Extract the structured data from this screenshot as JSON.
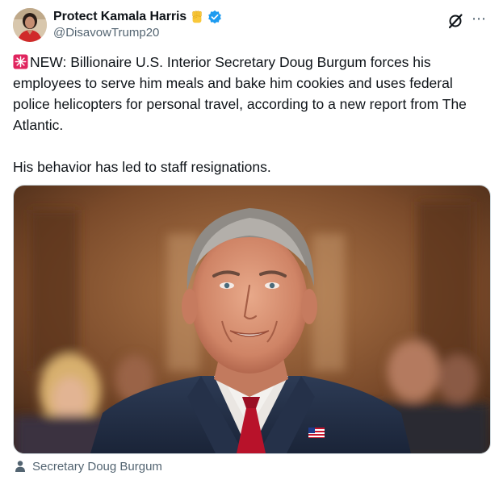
{
  "author": {
    "display_name": "Protect Kamala Harris",
    "handle": "@DisavowTrump20"
  },
  "header_icons": [
    "raised-fist-emoji-icon",
    "verified-badge-icon",
    "grok-icon",
    "more-options-icon"
  ],
  "tweet": {
    "paragraph_1": "NEW: Billionaire U.S. Interior Secretary Doug Burgum forces his employees to serve him meals and bake him cookies and uses federal police helicopters for personal travel, according to a new report from The Atlantic.",
    "paragraph_2": "His behavior has led to staff resignations."
  },
  "media": {
    "caption": "Secretary Doug Burgum"
  },
  "colors": {
    "text": "#0f1419",
    "secondary": "#536471",
    "verified": "#1d9bf0",
    "siren": "#e0245e"
  }
}
